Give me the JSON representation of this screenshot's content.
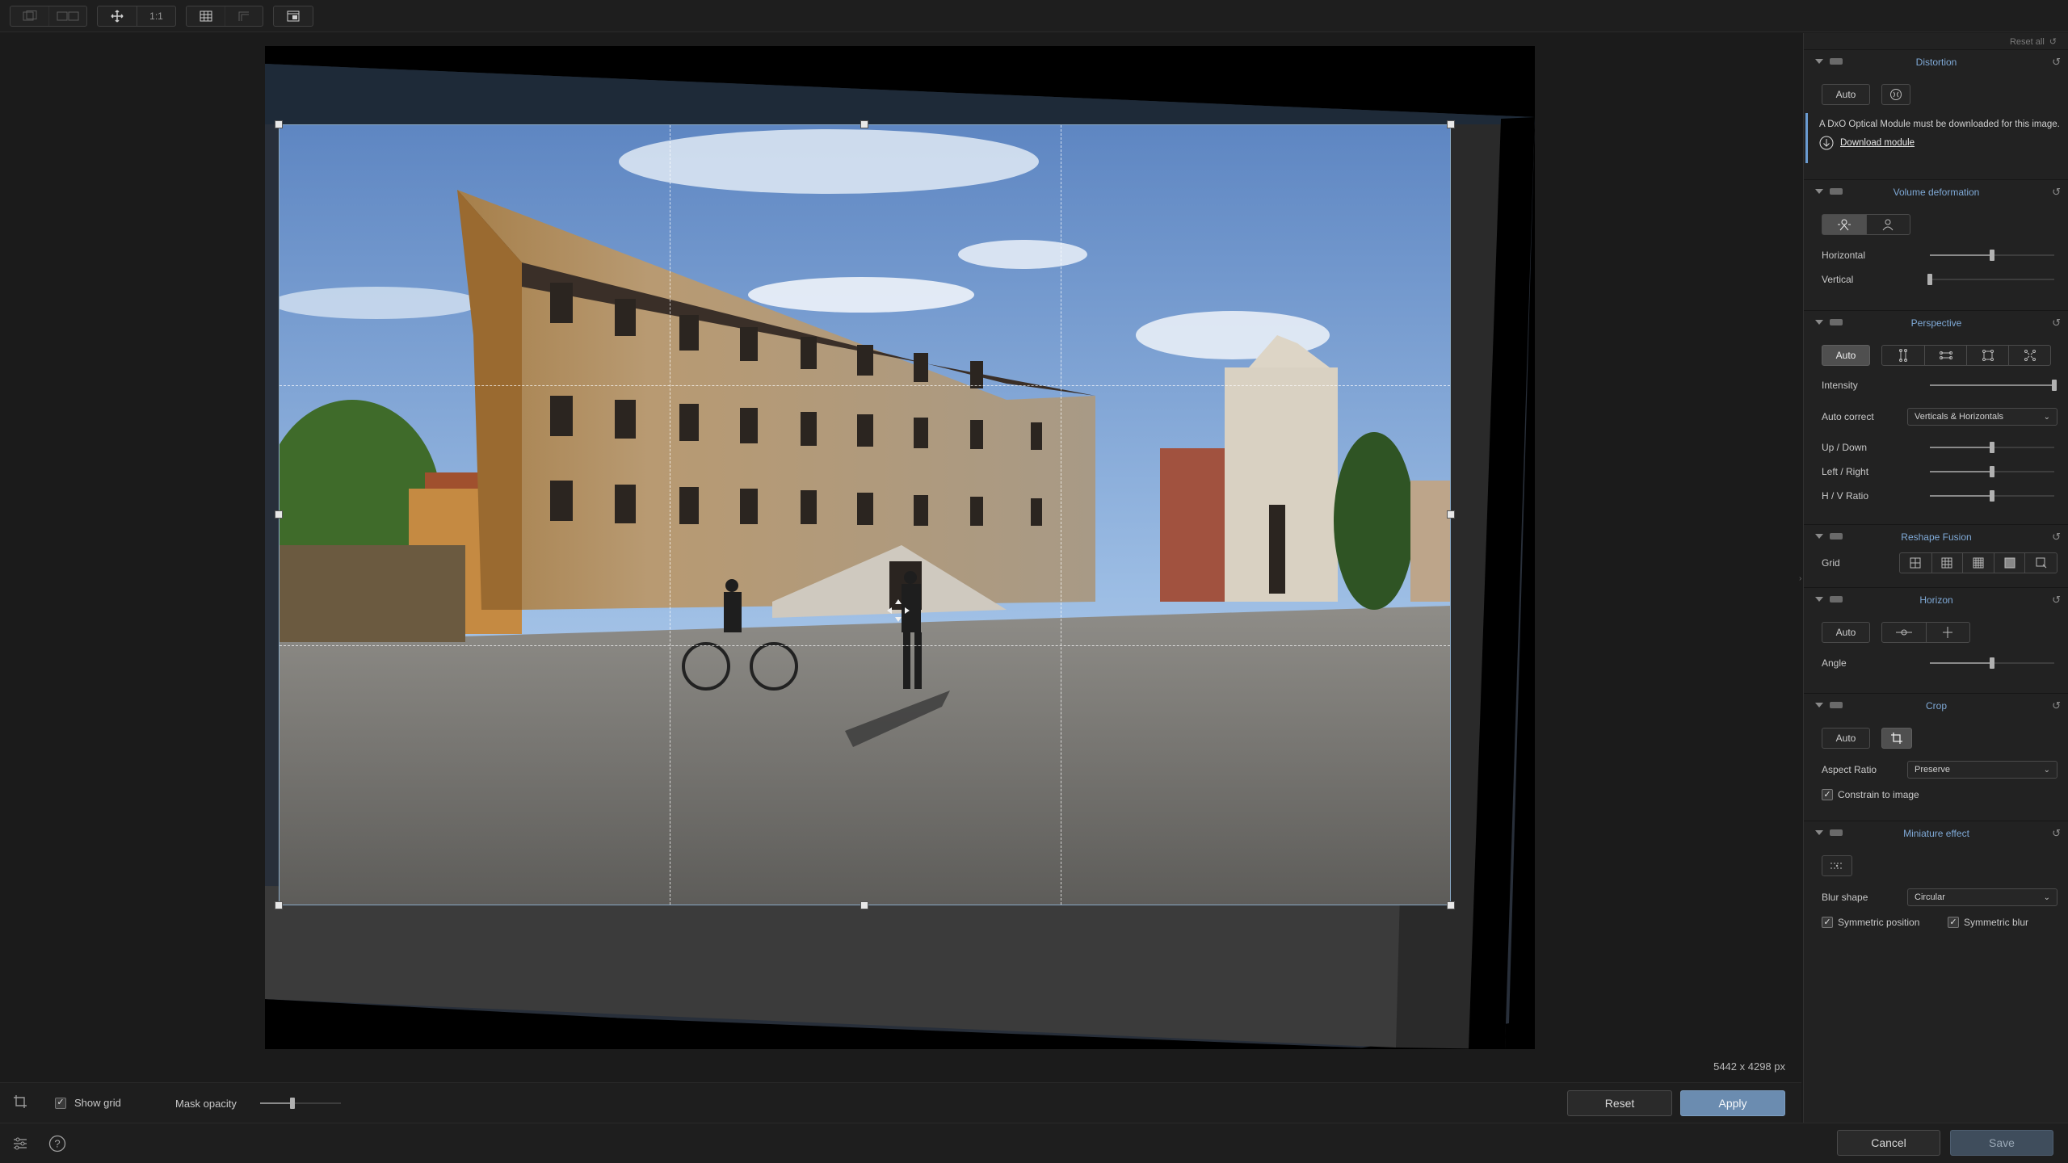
{
  "toolbar": {
    "one_to_one": "1:1",
    "icons": [
      "compare-single-icon",
      "compare-split-icon",
      "move-icon",
      "grid-icon",
      "guides-icon",
      "loupe-icon"
    ]
  },
  "canvas": {
    "dimensions": "5442 x 4298 px"
  },
  "cropbar": {
    "show_grid_label": "Show grid",
    "show_grid_checked": true,
    "mask_opacity_label": "Mask opacity",
    "mask_opacity_value": 0.4,
    "reset_label": "Reset",
    "apply_label": "Apply"
  },
  "statusbar": {
    "cancel_label": "Cancel",
    "save_label": "Save"
  },
  "panel": {
    "reset_all": "Reset all",
    "distortion": {
      "title": "Distortion",
      "auto_label": "Auto",
      "notice_text": "A DxO Optical Module must be downloaded for this image.",
      "download_label": "Download module"
    },
    "volume": {
      "title": "Volume deformation",
      "horizontal_label": "Horizontal",
      "horizontal_value": 0.5,
      "vertical_label": "Vertical",
      "vertical_value": 0.0
    },
    "perspective": {
      "title": "Perspective",
      "auto_label": "Auto",
      "intensity_label": "Intensity",
      "intensity_value": 1.0,
      "auto_correct_label": "Auto correct",
      "auto_correct_value": "Verticals & Horizontals",
      "updown_label": "Up / Down",
      "updown_value": 0.5,
      "leftright_label": "Left / Right",
      "leftright_value": 0.5,
      "hv_label": "H / V Ratio",
      "hv_value": 0.5
    },
    "reshape": {
      "title": "Reshape Fusion",
      "grid_label": "Grid"
    },
    "horizon": {
      "title": "Horizon",
      "auto_label": "Auto",
      "angle_label": "Angle",
      "angle_value": 0.5
    },
    "crop": {
      "title": "Crop",
      "auto_label": "Auto",
      "aspect_label": "Aspect Ratio",
      "aspect_value": "Preserve",
      "constrain_label": "Constrain to image",
      "constrain_checked": true
    },
    "miniature": {
      "title": "Miniature effect",
      "blur_shape_label": "Blur shape",
      "blur_shape_value": "Circular",
      "sym_position_label": "Symmetric position",
      "sym_position_checked": true,
      "sym_blur_label": "Symmetric blur",
      "sym_blur_checked": true
    }
  },
  "colors": {
    "accent": "#7fa9d6",
    "apply": "#6b8cb0",
    "crop_border": "#8aa9c6"
  }
}
